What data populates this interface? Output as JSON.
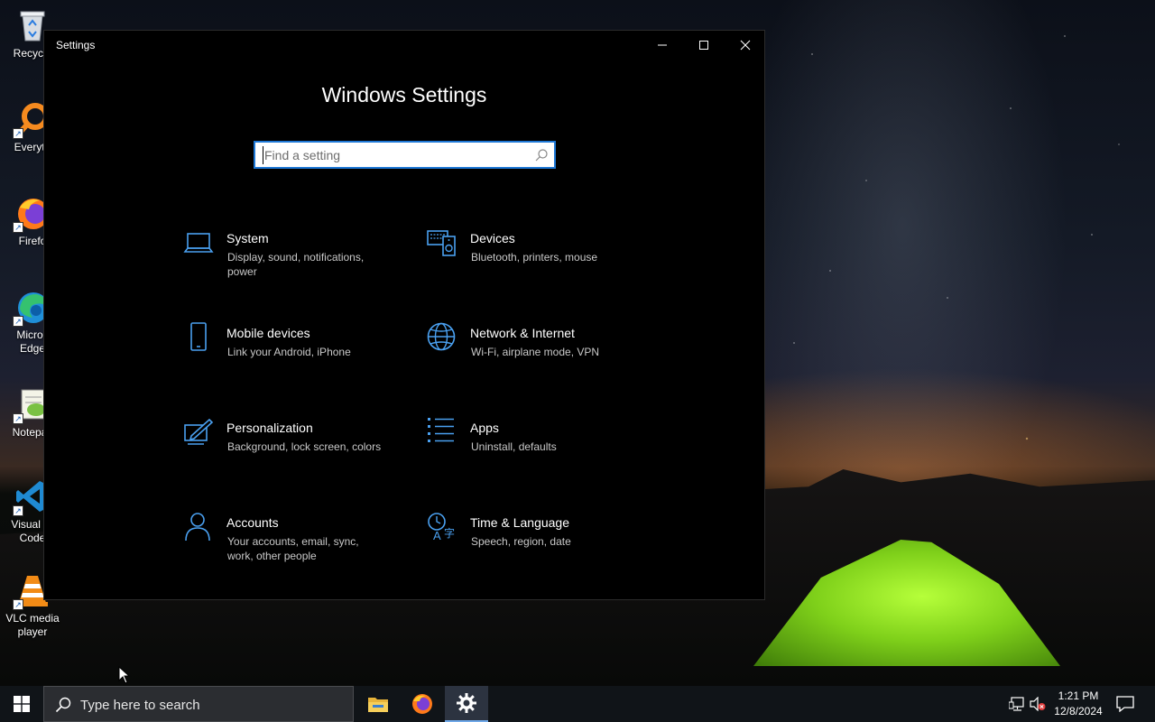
{
  "desktop": {
    "icons": [
      {
        "label": "Recycle",
        "icon": "recycle-bin-icon"
      },
      {
        "label": "Everyth",
        "icon": "everything-search-icon"
      },
      {
        "label": "Firefo",
        "icon": "firefox-icon"
      },
      {
        "label": "Micros\nEdge",
        "icon": "edge-icon"
      },
      {
        "label": "Notepac",
        "icon": "notepad-plus-plus-icon"
      },
      {
        "label": "Visual St\nCode",
        "icon": "vscode-icon"
      },
      {
        "label": "VLC media\nplayer",
        "icon": "vlc-icon"
      }
    ]
  },
  "window": {
    "title": "Settings",
    "heading": "Windows Settings",
    "search_placeholder": "Find a setting",
    "controls": {
      "minimize": "minimize-icon",
      "maximize": "maximize-icon",
      "close": "close-icon"
    }
  },
  "categories": [
    {
      "title": "System",
      "desc": "Display, sound, notifications, power",
      "icon": "laptop-icon"
    },
    {
      "title": "Devices",
      "desc": "Bluetooth, printers, mouse",
      "icon": "devices-icon"
    },
    {
      "title": "Mobile devices",
      "desc": "Link your Android, iPhone",
      "icon": "phone-icon"
    },
    {
      "title": "Network & Internet",
      "desc": "Wi-Fi, airplane mode, VPN",
      "icon": "globe-icon"
    },
    {
      "title": "Personalization",
      "desc": "Background, lock screen, colors",
      "icon": "personalization-icon"
    },
    {
      "title": "Apps",
      "desc": "Uninstall, defaults",
      "icon": "apps-list-icon"
    },
    {
      "title": "Accounts",
      "desc": "Your accounts, email, sync, work, other people",
      "icon": "person-icon"
    },
    {
      "title": "Time & Language",
      "desc": "Speech, region, date",
      "icon": "time-language-icon"
    }
  ],
  "taskbar": {
    "search_text": "Type here to search",
    "apps": [
      "file-explorer-icon",
      "firefox-icon",
      "settings-gear-icon"
    ],
    "active_app": "settings-gear-icon",
    "time": "1:21 PM",
    "date": "12/8/2024"
  },
  "colors": {
    "accent": "#1e78d6",
    "icon_blue": "#4aa0f0",
    "window_bg": "#000000",
    "taskbar_bg": "#101418"
  }
}
